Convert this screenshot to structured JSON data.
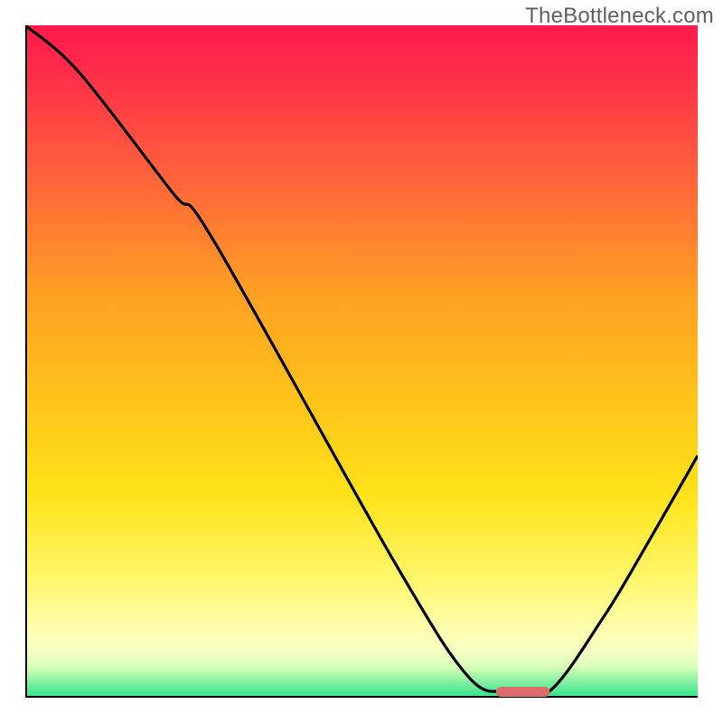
{
  "watermark": "TheBottleneck.com",
  "chart_data": {
    "type": "line",
    "title": "",
    "xlabel": "",
    "ylabel": "",
    "xlim": [
      0,
      100
    ],
    "ylim": [
      0,
      100
    ],
    "grid": false,
    "background": {
      "type": "vertical-gradient",
      "stops": [
        {
          "pos": 0.0,
          "color": "#ff1a4b"
        },
        {
          "pos": 0.06,
          "color": "#ff2a4a"
        },
        {
          "pos": 0.2,
          "color": "#ff5a3e"
        },
        {
          "pos": 0.4,
          "color": "#ffa024"
        },
        {
          "pos": 0.55,
          "color": "#ffc21a"
        },
        {
          "pos": 0.7,
          "color": "#ffe31a"
        },
        {
          "pos": 0.82,
          "color": "#fff66a"
        },
        {
          "pos": 0.9,
          "color": "#ffffb0"
        },
        {
          "pos": 0.93,
          "color": "#f6ffc4"
        },
        {
          "pos": 0.955,
          "color": "#d6ffb8"
        },
        {
          "pos": 0.975,
          "color": "#8af0a4"
        },
        {
          "pos": 1.0,
          "color": "#2ee38a"
        }
      ]
    },
    "series": [
      {
        "name": "bottleneck-curve",
        "x": [
          0,
          8,
          22,
          28,
          55,
          66,
          72,
          78,
          86,
          92,
          100
        ],
        "y": [
          100,
          93,
          75,
          68,
          20,
          3,
          1,
          1,
          12,
          22,
          36
        ]
      }
    ],
    "marker": {
      "name": "optimal-region",
      "x_start": 70,
      "x_end": 78,
      "y": 0,
      "color": "#dc6b6b"
    }
  }
}
